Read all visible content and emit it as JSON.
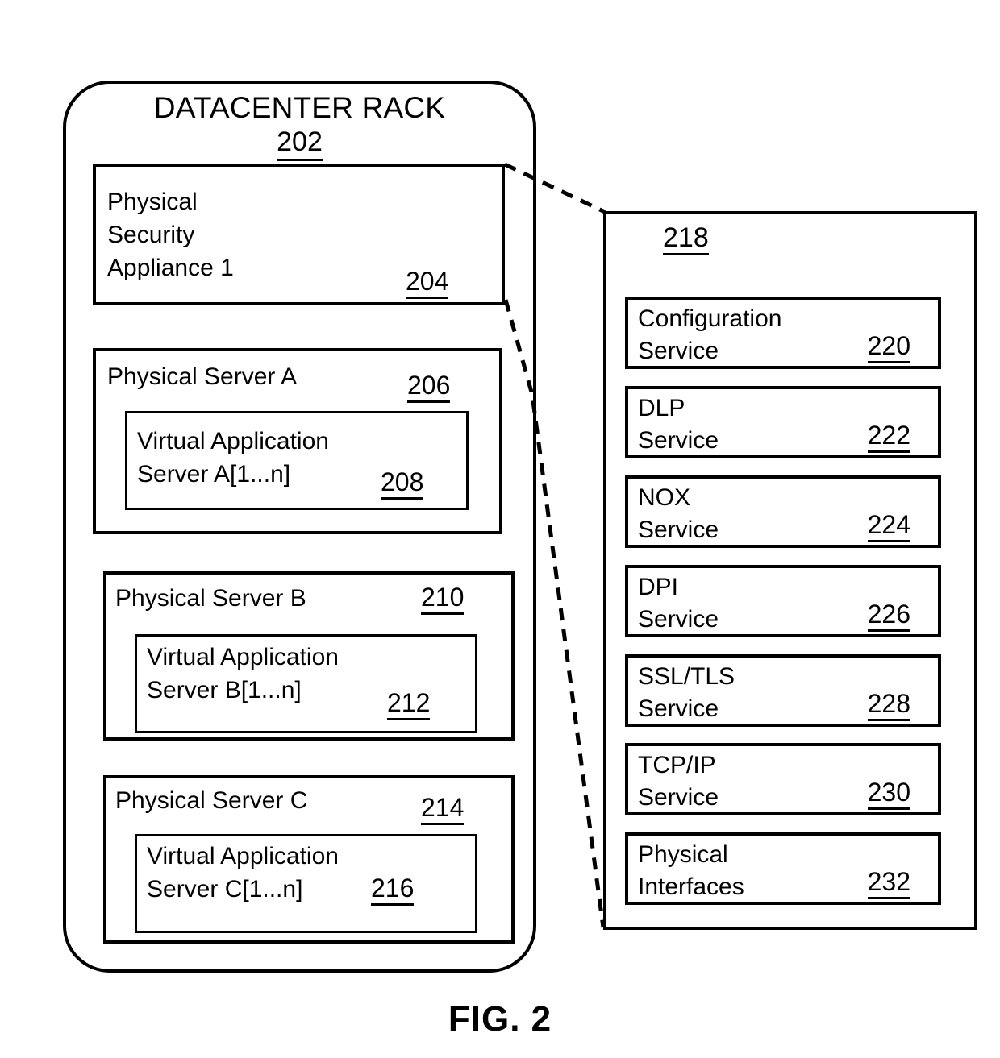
{
  "figure": {
    "caption": "FIG. 2"
  },
  "rack": {
    "title": "DATACENTER RACK",
    "ref": "202"
  },
  "appliance": {
    "label": "Physical\nSecurity\nAppliance 1",
    "ref": "204"
  },
  "servers": [
    {
      "label": "Physical Server A",
      "ref": "206",
      "vm": {
        "label": "Virtual Application\nServer A[1...n]",
        "ref": "208"
      }
    },
    {
      "label": "Physical Server B",
      "ref": "210",
      "vm": {
        "label": "Virtual Application\nServer B[1...n]",
        "ref": "212"
      }
    },
    {
      "label": "Physical Server C",
      "ref": "214",
      "vm": {
        "label": "Virtual Application\nServer C[1...n]",
        "ref": "216"
      }
    }
  ],
  "detail_panel": {
    "ref": "218",
    "services": [
      {
        "label": "Configuration\nService",
        "ref": "220"
      },
      {
        "label": "DLP\nService",
        "ref": "222"
      },
      {
        "label": "NOX\nService",
        "ref": "224"
      },
      {
        "label": "DPI\nService",
        "ref": "226"
      },
      {
        "label": "SSL/TLS\nService",
        "ref": "228"
      },
      {
        "label": "TCP/IP\nService",
        "ref": "230"
      },
      {
        "label": "Physical\nInterfaces",
        "ref": "232"
      }
    ]
  },
  "style": {
    "line_color": "#000000",
    "background": "#ffffff"
  }
}
